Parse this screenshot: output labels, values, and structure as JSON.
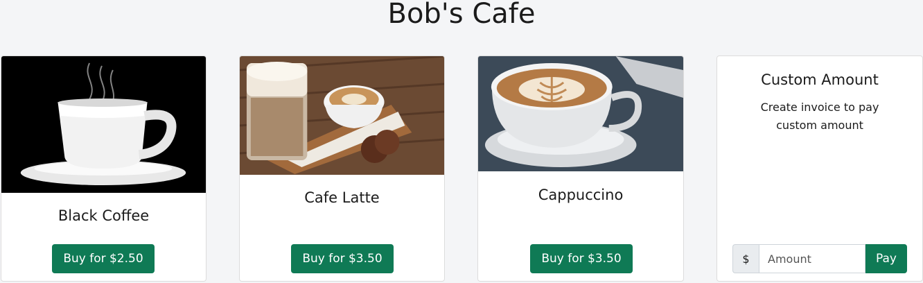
{
  "header": {
    "title": "Bob's Cafe"
  },
  "products": [
    {
      "name": "Black Coffee",
      "button_label": "Buy for $2.50"
    },
    {
      "name": "Cafe Latte",
      "button_label": "Buy for $3.50"
    },
    {
      "name": "Cappuccino",
      "button_label": "Buy for $3.50"
    }
  ],
  "custom": {
    "title": "Custom Amount",
    "description": "Create invoice to pay custom amount",
    "currency_symbol": "$",
    "amount_placeholder": "Amount",
    "pay_label": "Pay"
  },
  "colors": {
    "accent": "#0f7a55",
    "background": "#f4f5f7"
  }
}
